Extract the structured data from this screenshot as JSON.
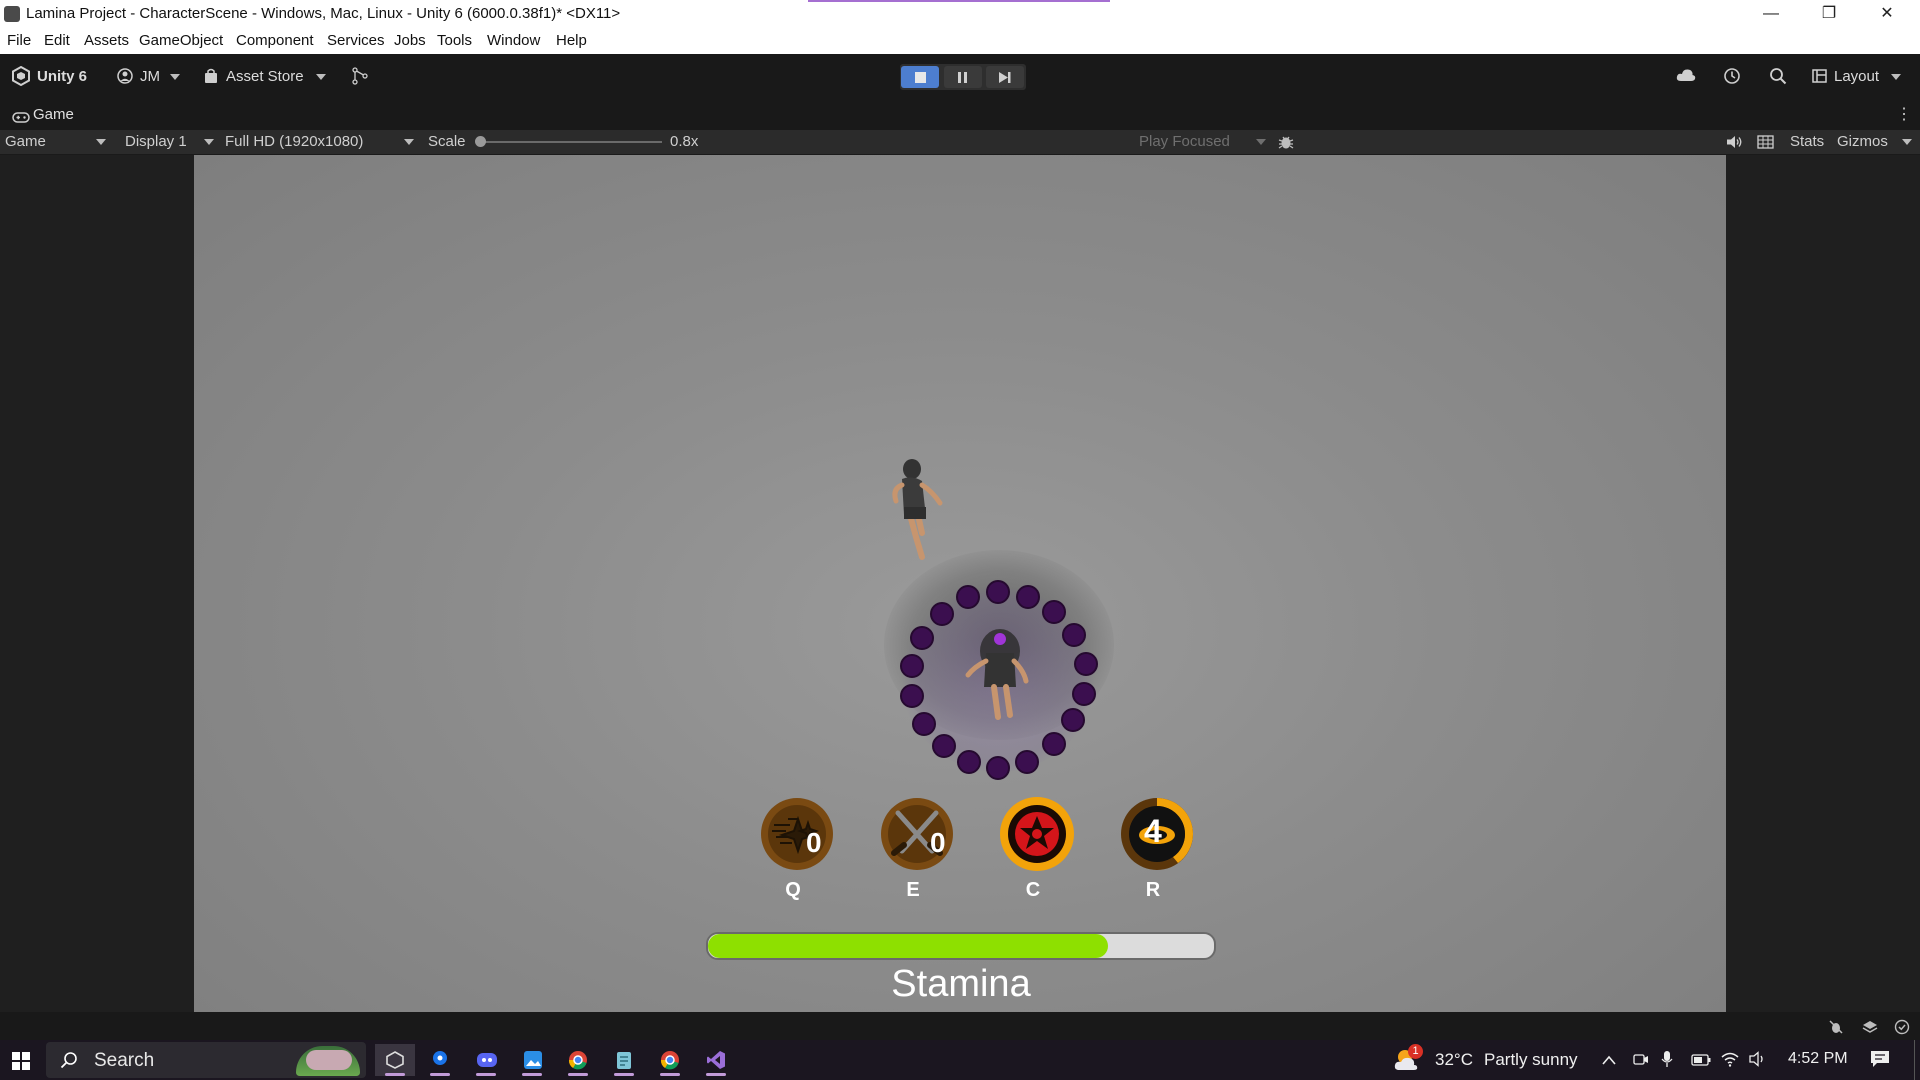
{
  "window": {
    "title": "Lamina Project - CharacterScene - Windows, Mac, Linux - Unity 6 (6000.0.38f1)* <DX11>",
    "controls": {
      "minimize": "—",
      "restore": "❐",
      "close": "✕"
    }
  },
  "menu": [
    "File",
    "Edit",
    "Assets",
    "GameObject",
    "Component",
    "Services",
    "Jobs",
    "Tools",
    "Window",
    "Help"
  ],
  "toolbar": {
    "unity_label": "Unity 6",
    "account": "JM",
    "asset_store": "Asset Store",
    "layout": "Layout",
    "play_active_color": "#4d7ecf"
  },
  "game_tab": {
    "label": "Game"
  },
  "game_bar": {
    "mode": "Game",
    "display": "Display 1",
    "resolution": "Full HD (1920x1080)",
    "scale_label": "Scale",
    "scale_value": "0.8x",
    "play_focused": "Play Focused",
    "stats": "Stats",
    "gizmos": "Gizmos"
  },
  "hud": {
    "skills": [
      {
        "key": "Q",
        "count": "0",
        "icon": "shuriken-icon",
        "ring_color": "#6e4512"
      },
      {
        "key": "E",
        "count": "0",
        "icon": "crossed-swords-icon",
        "ring_color": "#6e4512"
      },
      {
        "key": "C",
        "count": "",
        "icon": "sharingan-icon",
        "ring_color": "#f3a30a"
      },
      {
        "key": "R",
        "count": "4",
        "icon": "ultimate-icon",
        "ring_color": "#f3a30a"
      }
    ],
    "stamina": {
      "label": "Stamina",
      "value": 0.79,
      "fill_color": "#8ee000"
    }
  },
  "taskbar": {
    "search_placeholder": "Search",
    "weather_temp": "32°C",
    "weather_desc": "Partly sunny",
    "time": "4:52 PM",
    "weather_badge": "1"
  }
}
